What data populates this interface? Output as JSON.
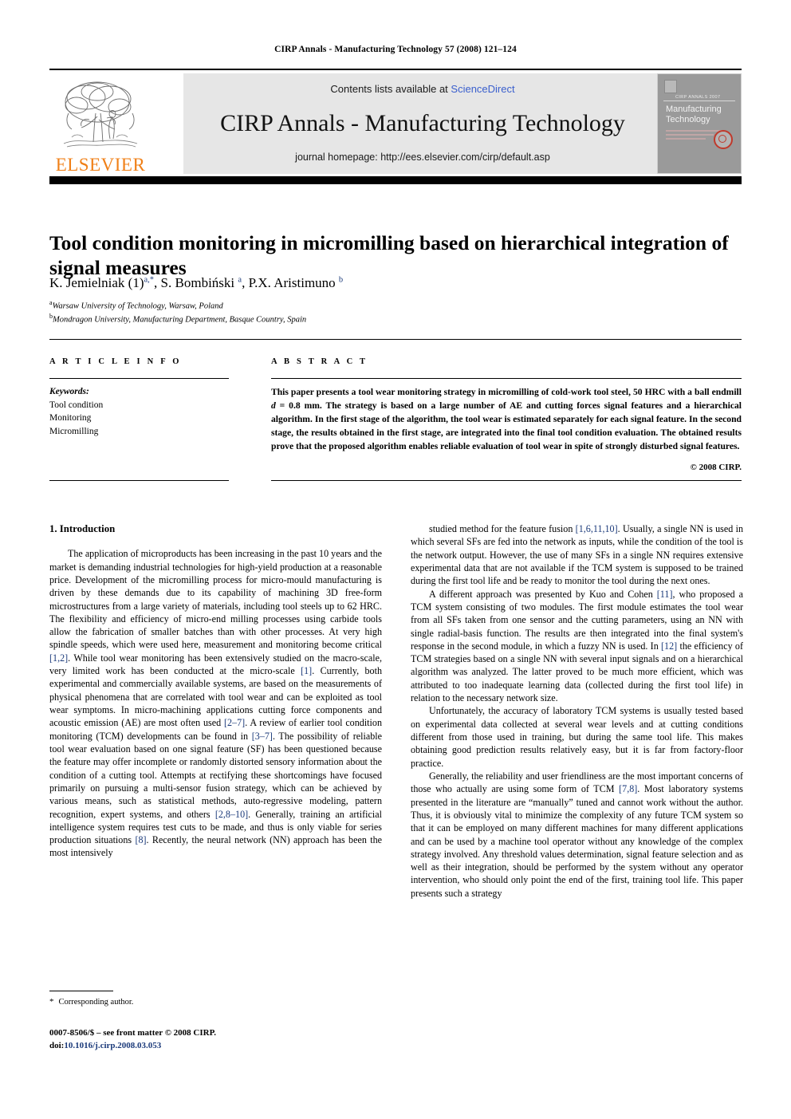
{
  "running_head": "CIRP Annals - Manufacturing Technology 57 (2008) 121–124",
  "header": {
    "publisher_logo_word": "ELSEVIER",
    "contents_prefix": "Contents lists available at ",
    "sciencedirect": "ScienceDirect",
    "journal_title": "CIRP Annals - Manufacturing Technology",
    "homepage": "journal homepage: http://ees.elsevier.com/cirp/default.asp",
    "cover": {
      "kicker": "CIRP ANNALS 2007",
      "title_line1": "Manufacturing",
      "title_line2": "Technology"
    }
  },
  "article": {
    "title": "Tool condition monitoring in micromilling based on hierarchical integration of signal measures",
    "authors_html": "K. Jemielniak (1)<sup>a,*</sup>, S. Bombiński <sup>a</sup>, P.X. Aristimuno <sup>b</sup>",
    "affiliation_a": "Warsaw University of Technology, Warsaw, Poland",
    "affiliation_b": "Mondragon University, Manufacturing Department, Basque Country, Spain"
  },
  "info": {
    "section_label": "A R T I C L E   I N F O",
    "keywords_heading": "Keywords:",
    "keywords": [
      "Tool condition",
      "Monitoring",
      "Micromilling"
    ]
  },
  "abstract": {
    "section_label": "A B S T R A C T",
    "text_html": "This paper presents a tool wear monitoring strategy in micromilling of cold-work tool steel, 50 HRC with a ball endmill <i>d</i> = 0.8 mm. The strategy is based on a large number of AE and cutting forces signal features and a hierarchical algorithm. In the first stage of the algorithm, the tool wear is estimated separately for each signal feature. In the second stage, the results obtained in the first stage, are integrated into the final tool condition evaluation. The obtained results prove that the proposed algorithm enables reliable evaluation of tool wear in spite of strongly disturbed signal features.",
    "copyright": "© 2008 CIRP."
  },
  "body": {
    "section_number_title": "1. Introduction",
    "left_paragraphs_html": [
      "The application of microproducts has been increasing in the past 10 years and the market is demanding industrial technologies for high-yield production at a reasonable price. Development of the micromilling process for micro-mould manufacturing is driven by these demands due to its capability of machining 3D free-form microstructures from a large variety of materials, including tool steels up to 62 HRC. The flexibility and efficiency of micro-end milling processes using carbide tools allow the fabrication of smaller batches than with other processes. At very high spindle speeds, which were used here, measurement and monitoring become critical <span class=\"ref\">[1,2]</span>. While tool wear monitoring has been extensively studied on the macro-scale, very limited work has been conducted at the micro-scale <span class=\"ref\">[1]</span>. Currently, both experimental and commercially available systems, are based on the measurements of physical phenomena that are correlated with tool wear and can be exploited as tool wear symptoms. In micro-machining applications cutting force components and acoustic emission (AE) are most often used <span class=\"ref\">[2–7]</span>. A review of earlier tool condition monitoring (TCM) developments can be found in <span class=\"ref\">[3–7]</span>. The possibility of reliable tool wear evaluation based on one signal feature (SF) has been questioned because the feature may offer incomplete or randomly distorted sensory information about the condition of a cutting tool. Attempts at rectifying these shortcomings have focused primarily on pursuing a multi-sensor fusion strategy, which can be achieved by various means, such as statistical methods, auto-regressive modeling, pattern recognition, expert systems, and others <span class=\"ref\">[2,8–10]</span>. Generally, training an artificial intelligence system requires test cuts to be made, and thus is only viable for series production situations <span class=\"ref\">[8]</span>. Recently, the neural network (NN) approach has been the most intensively"
    ],
    "right_paragraphs_html": [
      "studied method for the feature fusion <span class=\"ref\">[1,6,11,10]</span>. Usually, a single NN is used in which several SFs are fed into the network as inputs, while the condition of the tool is the network output. However, the use of many SFs in a single NN requires extensive experimental data that are not available if the TCM system is supposed to be trained during the first tool life and be ready to monitor the tool during the next ones.",
      "A different approach was presented by Kuo and Cohen <span class=\"ref\">[11]</span>, who proposed a TCM system consisting of two modules. The first module estimates the tool wear from all SFs taken from one sensor and the cutting parameters, using an NN with single radial-basis function. The results are then integrated into the final system's response in the second module, in which a fuzzy NN is used. In <span class=\"ref\">[12]</span> the efficiency of TCM strategies based on a single NN with several input signals and on a hierarchical algorithm was analyzed. The latter proved to be much more efficient, which was attributed to too inadequate learning data (collected during the first tool life) in relation to the necessary network size.",
      "Unfortunately, the accuracy of laboratory TCM systems is usually tested based on experimental data collected at several wear levels and at cutting conditions different from those used in training, but during the same tool life. This makes obtaining good prediction results relatively easy, but it is far from factory-floor practice.",
      "Generally, the reliability and user friendliness are the most important concerns of those who actually are using some form of TCM <span class=\"ref\">[7,8]</span>. Most laboratory systems presented in the literature are “manually” tuned and cannot work without the author. Thus, it is obviously vital to minimize the complexity of any future TCM system so that it can be employed on many different machines for many different applications and can be used by a machine tool operator without any knowledge of the complex strategy involved. Any threshold values determination, signal feature selection and as well as their integration, should be performed by the system without any operator intervention, who should only point the end of the first, training tool life. This paper presents such a strategy"
    ]
  },
  "footer": {
    "footnote_marker": "*",
    "footnote_text": "Corresponding author.",
    "imprint_line1": "0007-8506/$ – see front matter © 2008 CIRP.",
    "doi_prefix": "doi:",
    "doi_value": "10.1016/j.cirp.2008.03.053"
  },
  "colors": {
    "link_blue": "#3a5fcd",
    "reference_blue": "#1b3a7a",
    "elsevier_orange": "#f08018",
    "header_band_gray": "#e6e6e6"
  }
}
